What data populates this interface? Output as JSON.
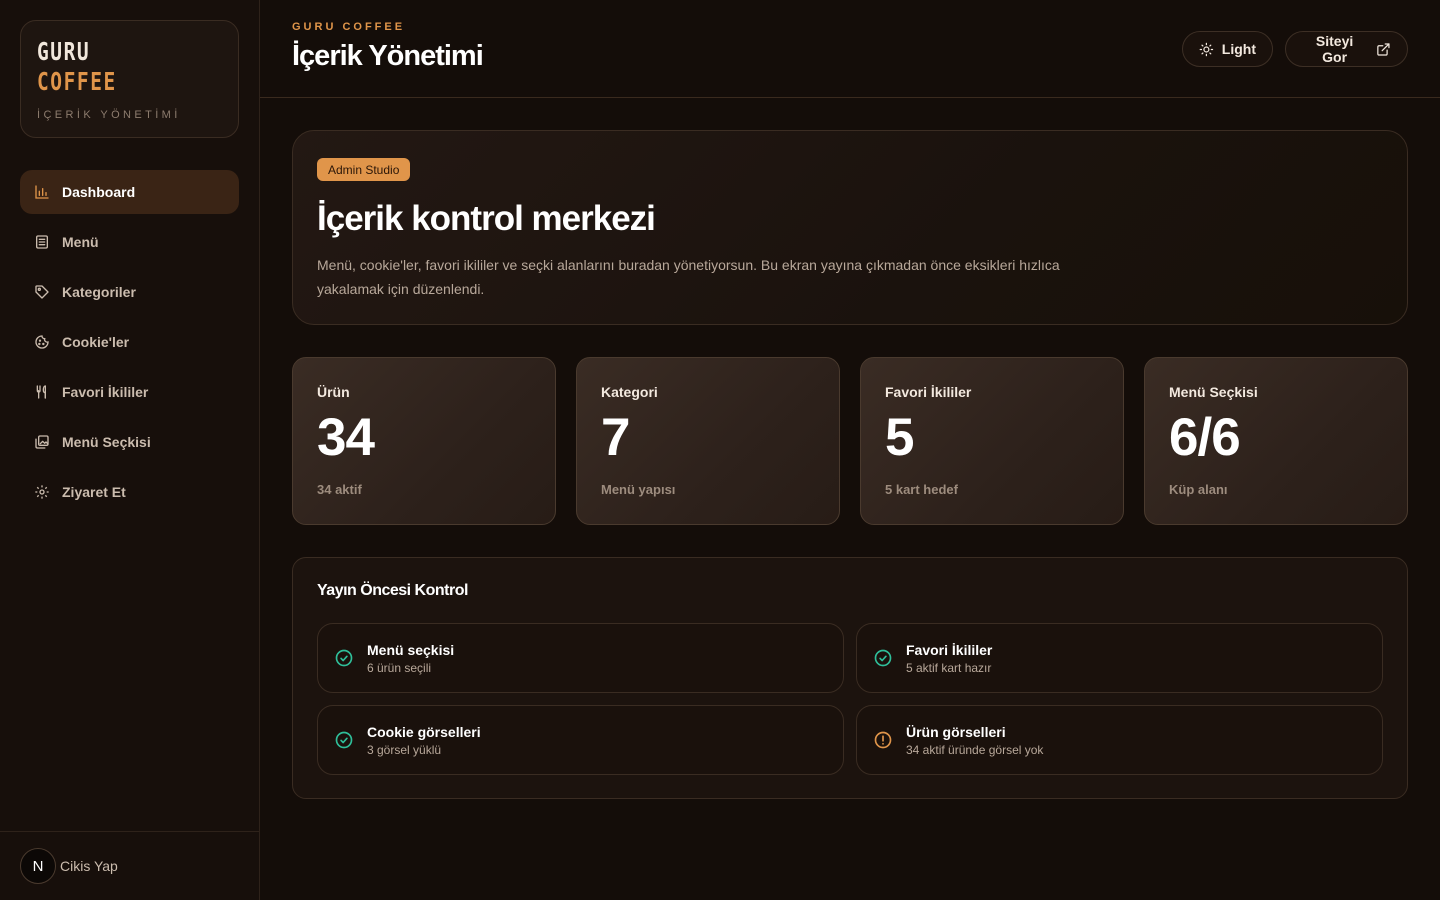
{
  "brand": {
    "line1": "GURU",
    "line2": "COFFEE",
    "subtitle": "İÇERİK YÖNETİMİ"
  },
  "sidebar": {
    "items": [
      {
        "label": "Dashboard",
        "icon": "bar-chart-icon",
        "active": true
      },
      {
        "label": "Menü",
        "icon": "list-icon",
        "active": false
      },
      {
        "label": "Kategoriler",
        "icon": "tag-icon",
        "active": false
      },
      {
        "label": "Cookie'ler",
        "icon": "cookie-icon",
        "active": false
      },
      {
        "label": "Favori İkililer",
        "icon": "utensils-icon",
        "active": false
      },
      {
        "label": "Menü Seçkisi",
        "icon": "images-icon",
        "active": false
      },
      {
        "label": "Ziyaret Et",
        "icon": "gear-icon",
        "active": false
      }
    ],
    "logout": {
      "avatar": "N",
      "label": "Cikis Yap"
    }
  },
  "header": {
    "eyebrow": "GURU COFFEE",
    "title": "İçerik Yönetimi",
    "theme_button": "Light",
    "site_button": "Siteyi Gor"
  },
  "hero": {
    "badge": "Admin Studio",
    "title": "İçerik kontrol merkezi",
    "description": "Menü, cookie'ler, favori ikililer ve seçki alanlarını buradan yönetiyorsun. Bu ekran yayına çıkmadan önce eksikleri hızlıca yakalamak için düzenlendi."
  },
  "stats": [
    {
      "label": "Ürün",
      "value": "34",
      "sub": "34 aktif"
    },
    {
      "label": "Kategori",
      "value": "7",
      "sub": "Menü yapısı"
    },
    {
      "label": "Favori İkililer",
      "value": "5",
      "sub": "5 kart hedef"
    },
    {
      "label": "Menü Seçkisi",
      "value": "6/6",
      "sub": "Küp alanı"
    }
  ],
  "checks": {
    "title": "Yayın Öncesi Kontrol",
    "items": [
      {
        "title": "Menü seçkisi",
        "sub": "6 ürün seçili",
        "status": "ok"
      },
      {
        "title": "Favori İkililer",
        "sub": "5 aktif kart hazır",
        "status": "ok"
      },
      {
        "title": "Cookie görselleri",
        "sub": "3 görsel yüklü",
        "status": "ok"
      },
      {
        "title": "Ürün görselleri",
        "sub": "34 aktif üründe görsel yok",
        "status": "warning"
      }
    ]
  },
  "colors": {
    "accent": "#e0954a",
    "ok": "#2fbf9a",
    "warning": "#e0954a",
    "background": "#140d09"
  }
}
